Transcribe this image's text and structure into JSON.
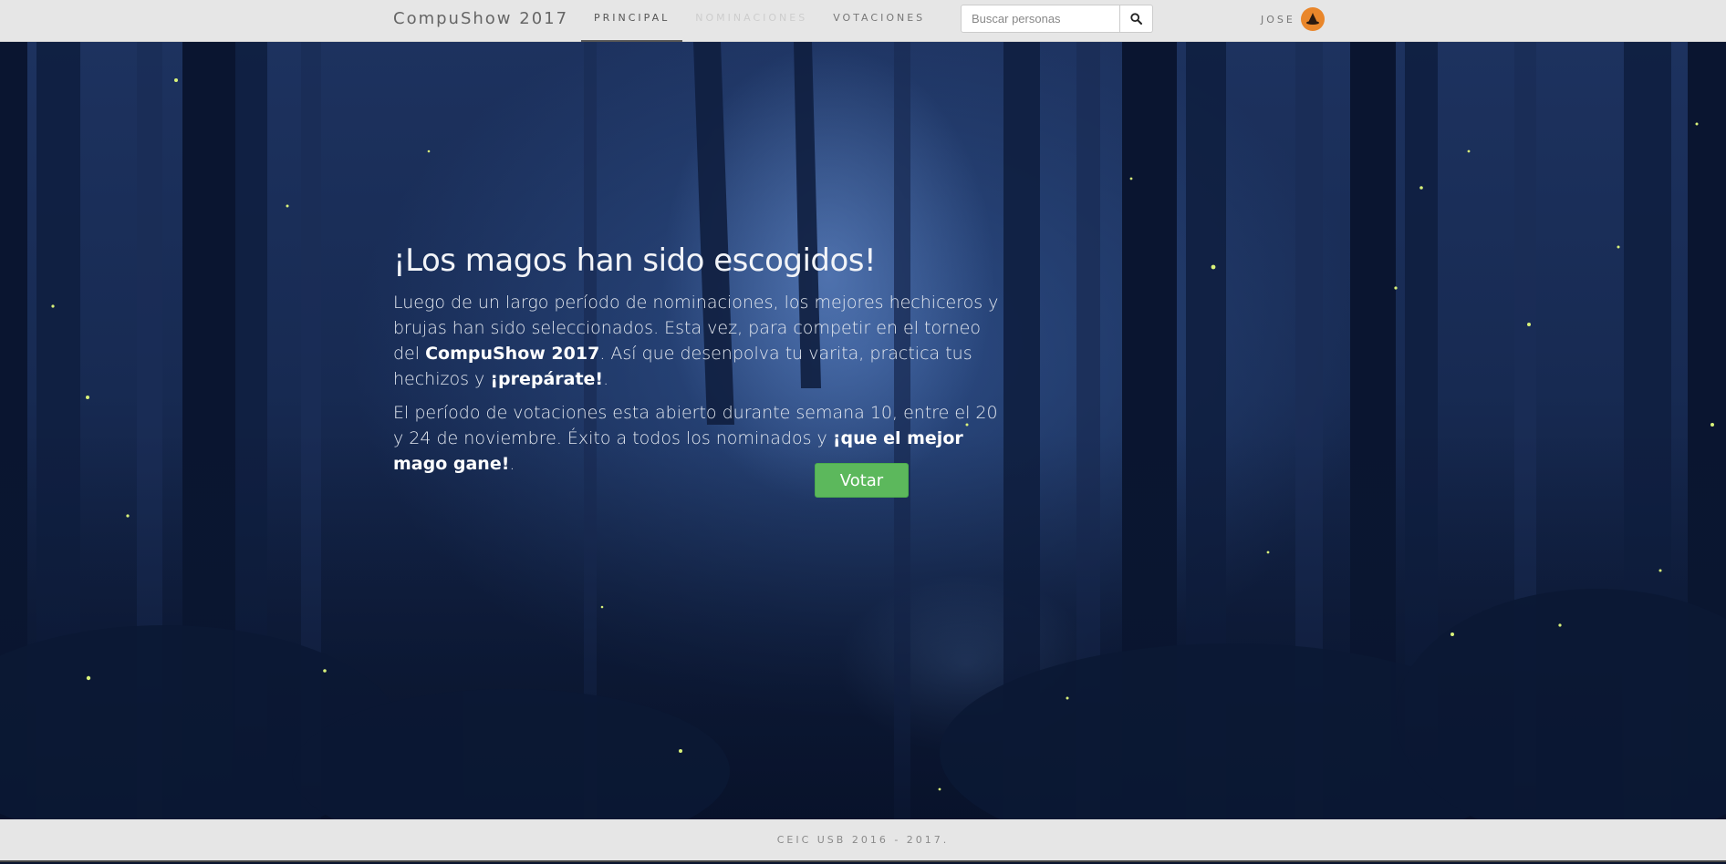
{
  "navbar": {
    "brand": "CompuShow 2017",
    "links": [
      {
        "label": "PRINCIPAL",
        "state": "active"
      },
      {
        "label": "NOMINACIONES",
        "state": "disabled"
      },
      {
        "label": "VOTACIONES",
        "state": "normal"
      }
    ],
    "search": {
      "placeholder": "Buscar personas",
      "value": "",
      "button_icon": "search-icon"
    },
    "user": {
      "name": "JOSE",
      "avatar_icon": "wizard-hat-icon",
      "avatar_color": "#e9862a"
    }
  },
  "hero": {
    "headline": "¡Los magos han sido escogidos!",
    "paragraph1": {
      "part1": "Luego de un largo período de nominaciones, los mejores hechiceros y brujas han sido seleccionados. Esta vez, para competir en el torneo del ",
      "bold1": "CompuShow 2017",
      "part2": ". Así que desenpolva tu varita, practica tus hechizos y ",
      "bold2": "¡prepárate!",
      "part3": "."
    },
    "paragraph2": {
      "part1": "El período de votaciones esta abierto durante semana 10, entre el 20 y 24 de noviembre. Éxito a todos los nominados y ",
      "bold1": "¡que el mejor mago gane!",
      "part2": "."
    },
    "vote_button": "Votar",
    "vote_button_color": "#5cb85c",
    "background": "dark-forest-with-fireflies"
  },
  "footer": {
    "text": "CEIC USB 2016 - 2017."
  }
}
